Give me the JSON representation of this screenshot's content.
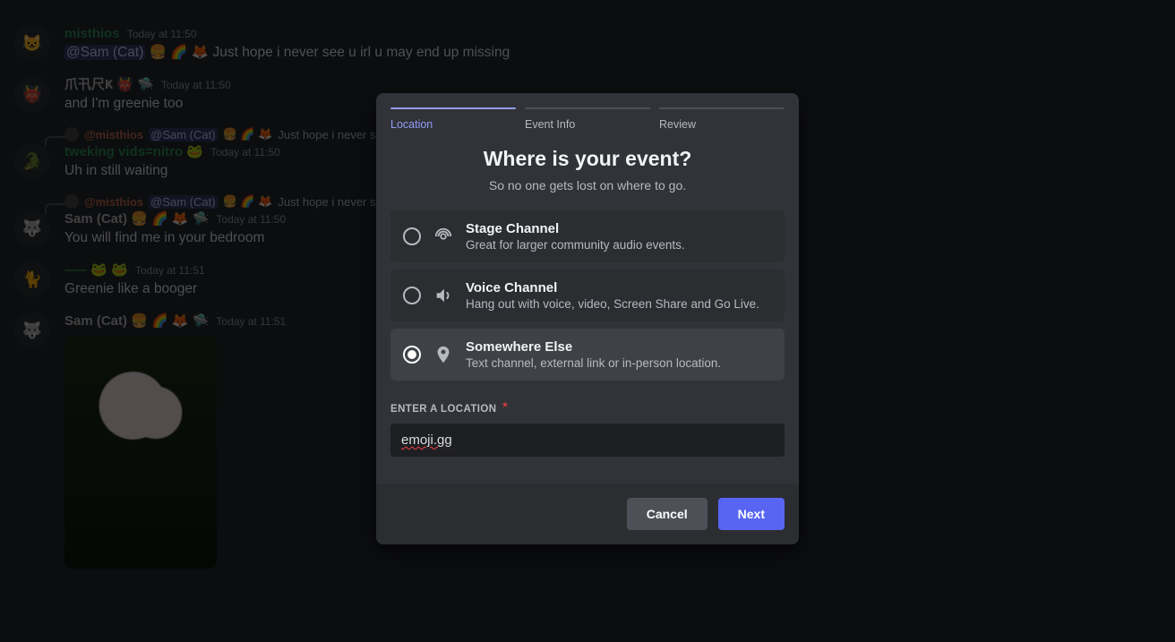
{
  "chat": {
    "m1": {
      "user": "misthios",
      "user_color": "#2e8b57",
      "time": "Today at 11:50",
      "mention": "@Sam (Cat)",
      "emojis": "🍔 🌈 🦊",
      "text": "  Just hope i never see u irl u may end up missing"
    },
    "m2": {
      "user": "爪卂尺Ҝ 👹 🛸",
      "user_color": "#b9bbbe",
      "time": "Today at 11:50",
      "text": "and I'm greenie too"
    },
    "m3": {
      "reply_user": "@misthios",
      "reply_mention": "@Sam (Cat)",
      "reply_emojis": "🍔 🌈 🦊",
      "reply_tail": "  Just hope i never se",
      "user": "tweking vids=nitro 🐸",
      "user_color": "#2e8b57",
      "time": "Today at 11:50",
      "text": "Uh in still waiting"
    },
    "m4": {
      "reply_user": "@misthios",
      "reply_mention": "@Sam (Cat)",
      "reply_emojis": "🍔 🌈 🦊",
      "reply_tail": "  Just hope i never se",
      "user": "Sam (Cat) 🍔 🌈 🦊 🛸",
      "user_color": "#b9bbbe",
      "time": "Today at 11:50",
      "text": "You will find me in your bedroom"
    },
    "m5": {
      "user": "⸺ 🐸 🐸",
      "user_color": "#2e8b57",
      "time": "Today at 11:51",
      "text": "Greenie like a booger"
    },
    "m6": {
      "user": "Sam (Cat) 🍔 🌈 🦊 🛸",
      "user_color": "#b9bbbe",
      "time": "Today at 11:51",
      "text": ""
    }
  },
  "modal": {
    "steps": {
      "s1": "Location",
      "s2": "Event Info",
      "s3": "Review"
    },
    "title": "Where is your event?",
    "subtitle": "So no one gets lost on where to go.",
    "opt1": {
      "title": "Stage Channel",
      "desc": "Great for larger community audio events."
    },
    "opt2": {
      "title": "Voice Channel",
      "desc": "Hang out with voice, video, Screen Share and Go Live."
    },
    "opt3": {
      "title": "Somewhere Else",
      "desc": "Text channel, external link or in-person location."
    },
    "field_label": "Enter a Location",
    "field_required": "*",
    "field_value": "emoji.gg",
    "cancel": "Cancel",
    "next": "Next"
  }
}
